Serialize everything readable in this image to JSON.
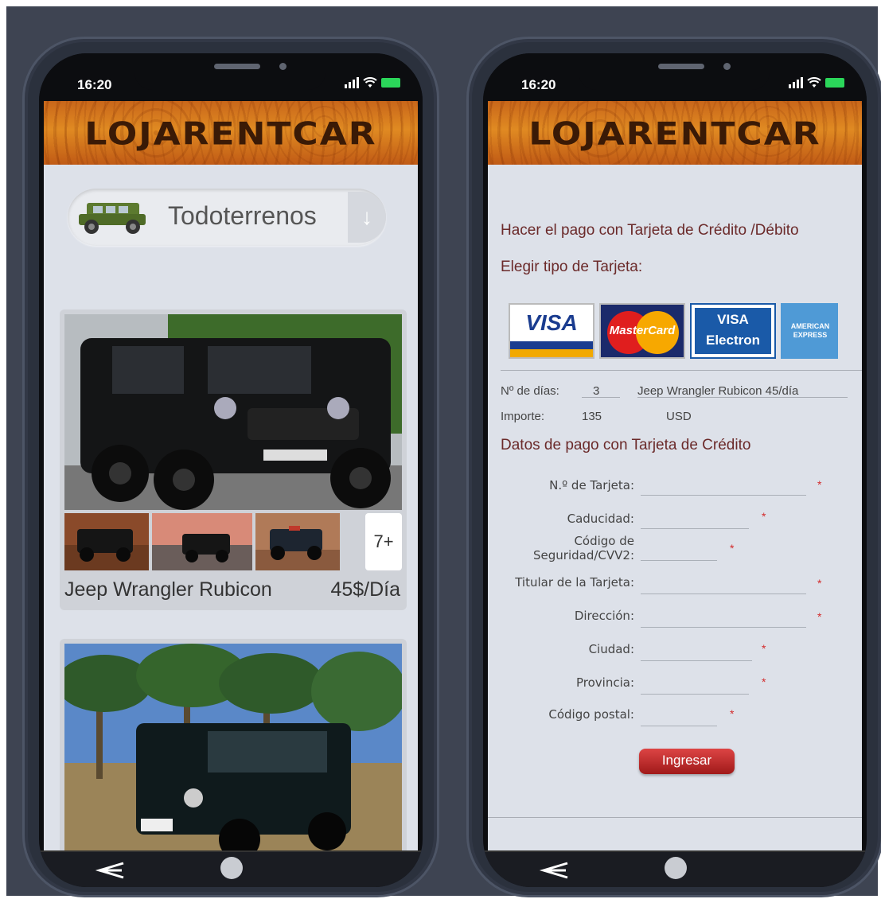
{
  "status_bar": {
    "time": "16:20"
  },
  "brand": {
    "logo_text": "LOJARENTCAR"
  },
  "left_screen": {
    "category_dropdown": {
      "selected": "Todoterrenos"
    },
    "vehicles": [
      {
        "name": "Jeep Wrangler Rubicon",
        "price": "45$/Día",
        "more_photos": "7+"
      },
      {
        "name": "",
        "price": ""
      }
    ]
  },
  "right_screen": {
    "payment_title": "Hacer el pago con Tarjeta de Crédito /Débito",
    "card_type_title": "Elegir tipo de Tarjeta:",
    "card_options": [
      "VISA",
      "MasterCard",
      "VISA Electron",
      "AMERICAN EXPRESS"
    ],
    "days_label": "Nº de días:",
    "days_value": "3",
    "vehicle_rate": "Jeep Wrangler Rubicon 45/día",
    "amount_label": "Importe:",
    "amount_value": "135",
    "currency": "USD",
    "form_title": "Datos de pago con Tarjeta de Crédito",
    "fields": {
      "card_number": "N.º de Tarjeta:",
      "expiry": "Caducidad:",
      "cvv_line1": "Código de",
      "cvv_line2": "Seguridad/CVV2:",
      "holder": "Titular de la Tarjeta:",
      "address": "Dirección:",
      "city": "Ciudad:",
      "province": "Provincia:",
      "postal": "Código postal:"
    },
    "required_mark": "*",
    "submit_label": "Ingresar"
  },
  "colors": {
    "header_orange": "#d9771e",
    "title_maroon": "#6b2a2a",
    "required_red": "#d32b2b",
    "submit_red": "#b02020",
    "battery_green": "#2bd65a"
  }
}
